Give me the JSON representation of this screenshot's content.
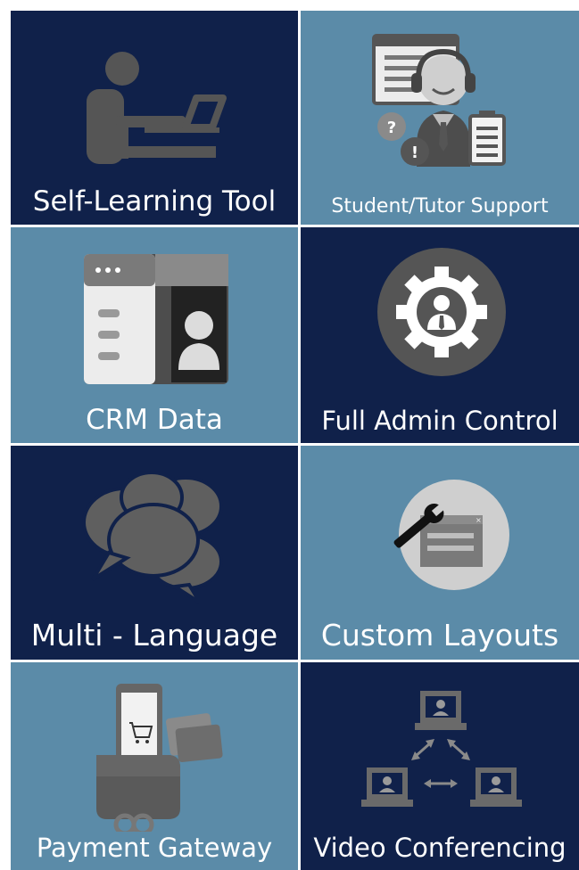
{
  "colors": {
    "dark_tile": "#10214a",
    "light_tile": "#5b8ba8",
    "label": "#ffffff",
    "icon_gray": "#4d4d4d"
  },
  "tiles": [
    {
      "label": "Self-Learning Tool",
      "icon": "person-at-laptop-icon"
    },
    {
      "label": "Student/Tutor Support",
      "icon": "support-agent-icon"
    },
    {
      "label": "CRM Data",
      "icon": "contact-card-icon"
    },
    {
      "label": "Full Admin Control",
      "icon": "admin-gear-icon"
    },
    {
      "label": "Multi - Language",
      "icon": "speech-bubbles-icon"
    },
    {
      "label": "Custom Layouts",
      "icon": "wrench-layout-icon"
    },
    {
      "label": "Payment Gateway",
      "icon": "wallet-phone-cart-icon"
    },
    {
      "label": "Video Conferencing",
      "icon": "video-network-icon"
    }
  ]
}
